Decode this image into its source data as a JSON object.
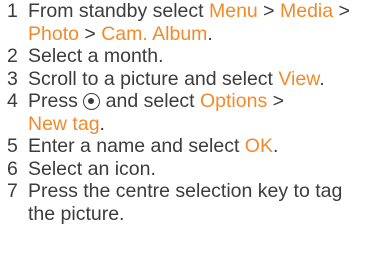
{
  "steps": [
    {
      "number": "1",
      "parts": [
        {
          "t": "From standby select ",
          "hl": false
        },
        {
          "t": "Menu",
          "hl": true
        },
        {
          "t": " > ",
          "hl": false
        },
        {
          "t": "Media",
          "hl": true
        },
        {
          "t": " >",
          "hl": false
        },
        {
          "br": true
        },
        {
          "t": "Photo",
          "hl": true
        },
        {
          "t": " > ",
          "hl": false
        },
        {
          "t": "Cam. Album",
          "hl": true
        },
        {
          "t": ".",
          "hl": false
        }
      ]
    },
    {
      "number": "2",
      "parts": [
        {
          "t": "Select a month.",
          "hl": false
        }
      ]
    },
    {
      "number": "3",
      "parts": [
        {
          "t": "Scroll to a picture and select ",
          "hl": false
        },
        {
          "t": "View",
          "hl": true
        },
        {
          "t": ".",
          "hl": false
        }
      ]
    },
    {
      "number": "4",
      "parts": [
        {
          "t": "Press ",
          "hl": false
        },
        {
          "icon": "joystick-center-icon"
        },
        {
          "t": " and select ",
          "hl": false
        },
        {
          "t": "Options",
          "hl": true
        },
        {
          "t": " >",
          "hl": false
        },
        {
          "br": true
        },
        {
          "t": "New tag",
          "hl": true
        },
        {
          "t": ".",
          "hl": false
        }
      ]
    },
    {
      "number": "5",
      "parts": [
        {
          "t": "Enter a name and select ",
          "hl": false
        },
        {
          "t": "OK",
          "hl": true
        },
        {
          "t": ".",
          "hl": false
        }
      ]
    },
    {
      "number": "6",
      "parts": [
        {
          "t": "Select an icon.",
          "hl": false
        }
      ]
    },
    {
      "number": "7",
      "parts": [
        {
          "t": "Press the centre selection key to tag",
          "hl": false
        },
        {
          "br": true
        },
        {
          "t": "the picture.",
          "hl": false
        }
      ]
    }
  ],
  "colors": {
    "text": "#3c3c3c",
    "highlight": "#f28a2b"
  }
}
